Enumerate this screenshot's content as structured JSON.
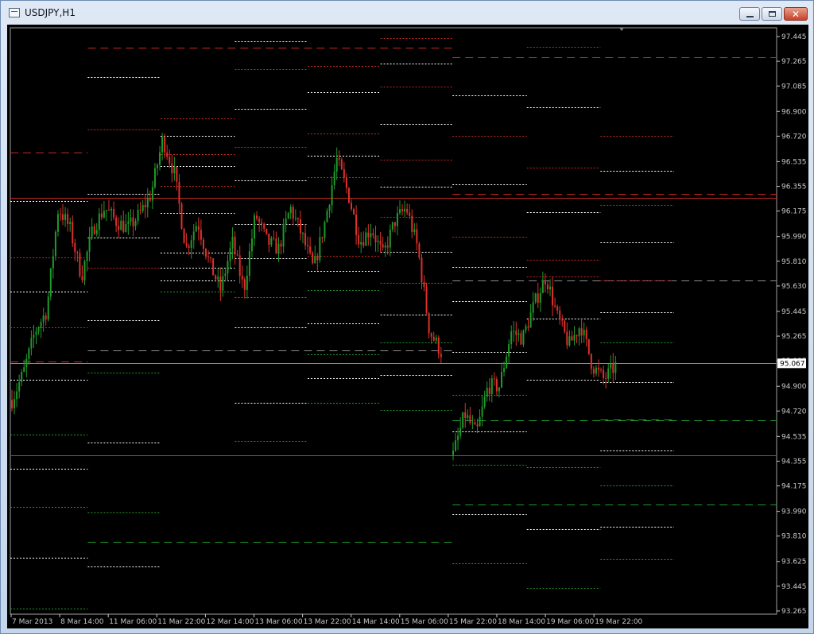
{
  "window": {
    "title": "USDJPY,H1",
    "buttons": {
      "minimize": "minimize",
      "maximize": "maximize",
      "close": "close"
    }
  },
  "colors": {
    "background": "#000000",
    "bull": "#1f9a2a",
    "bear": "#e0302a",
    "axis": "#c8c8c8",
    "level_white": "#ffffff",
    "level_red": "#c22a20",
    "level_green": "#1f9a2a",
    "level_gray": "#8c8c8c",
    "price_tag_bg": "#ffffff"
  },
  "chart_data": {
    "type": "candlestick",
    "symbol": "USDJPY",
    "timeframe": "H1",
    "ylim": [
      93.265,
      97.445
    ],
    "y_ticks": [
      "97.445",
      "97.265",
      "97.085",
      "96.900",
      "96.720",
      "96.535",
      "96.355",
      "96.175",
      "95.990",
      "95.810",
      "95.630",
      "95.445",
      "95.265",
      "95.085",
      "94.900",
      "94.720",
      "94.535",
      "94.355",
      "94.175",
      "93.990",
      "93.810",
      "93.625",
      "93.445",
      "93.265"
    ],
    "x_ticks": [
      "7 Mar 2013",
      "8 Mar 14:00",
      "11 Mar 06:00",
      "11 Mar 22:00",
      "12 Mar 14:00",
      "13 Mar 06:00",
      "13 Mar 22:00",
      "14 Mar 14:00",
      "15 Mar 06:00",
      "15 Mar 22:00",
      "18 Mar 14:00",
      "19 Mar 06:00",
      "19 Mar 22:00"
    ],
    "current_price": "95.067",
    "price_trend": [
      [
        94.8,
        95.0,
        95.3,
        95.45,
        96.2,
        96.05,
        95.7,
        96.05,
        96.2,
        96.1,
        96.05,
        96.15,
        96.3,
        96.7,
        96.45,
        95.9,
        96.1,
        95.8,
        95.6,
        95.95,
        95.6,
        96.15,
        95.95,
        95.9,
        96.2,
        96.0,
        95.75,
        96.1,
        96.55,
        96.3,
        95.95,
        96.05,
        95.85,
        96.1,
        96.2,
        95.9,
        95.3,
        95.15
      ],
      [
        94.4,
        94.7,
        94.55,
        94.9,
        94.9,
        95.3,
        95.25,
        95.5,
        95.7,
        95.4,
        95.2,
        95.35,
        95.05,
        94.95,
        95.05
      ]
    ],
    "levels": [
      {
        "color": "red",
        "dash": "long",
        "x0": 0.101,
        "x1": 0.577,
        "price": 97.365
      },
      {
        "color": "white",
        "dash": "short",
        "x0": 0.293,
        "x1": 0.388,
        "price": 97.41
      },
      {
        "color": "red",
        "dash": "short",
        "x0": 0.483,
        "x1": 0.577,
        "price": 97.435
      },
      {
        "color": "red",
        "dash": "long",
        "x0": 0.577,
        "x1": 1.0,
        "price": 97.295
      },
      {
        "color": "red",
        "dash": "short",
        "x0": 0.674,
        "x1": 0.77,
        "price": 97.37
      },
      {
        "color": "white",
        "dash": "short",
        "x0": 0.101,
        "x1": 0.196,
        "price": 97.15
      },
      {
        "color": "red",
        "dash": "short",
        "x0": 0.293,
        "x1": 0.388,
        "price": 97.21
      },
      {
        "color": "red",
        "dash": "short",
        "x0": 0.388,
        "x1": 0.483,
        "price": 97.23
      },
      {
        "color": "white",
        "dash": "short",
        "x0": 0.483,
        "x1": 0.577,
        "price": 97.25
      },
      {
        "color": "white",
        "dash": "short",
        "x0": 0.388,
        "x1": 0.483,
        "price": 97.04
      },
      {
        "color": "red",
        "dash": "short",
        "x0": 0.483,
        "x1": 0.577,
        "price": 97.08
      },
      {
        "color": "white",
        "dash": "short",
        "x0": 0.577,
        "x1": 0.674,
        "price": 97.02
      },
      {
        "color": "white",
        "dash": "short",
        "x0": 0.293,
        "x1": 0.388,
        "price": 96.92
      },
      {
        "color": "white",
        "dash": "short",
        "x0": 0.674,
        "x1": 0.77,
        "price": 96.93
      },
      {
        "color": "red",
        "dash": "short",
        "x0": 0.196,
        "x1": 0.293,
        "price": 96.85
      },
      {
        "color": "white",
        "dash": "short",
        "x0": 0.483,
        "x1": 0.577,
        "price": 96.81
      },
      {
        "color": "red",
        "dash": "short",
        "x0": 0.101,
        "x1": 0.196,
        "price": 96.77
      },
      {
        "color": "white",
        "dash": "short",
        "x0": 0.196,
        "x1": 0.293,
        "price": 96.72
      },
      {
        "color": "red",
        "dash": "short",
        "x0": 0.388,
        "x1": 0.483,
        "price": 96.74
      },
      {
        "color": "red",
        "dash": "short",
        "x0": 0.577,
        "x1": 0.674,
        "price": 96.72
      },
      {
        "color": "red",
        "dash": "short",
        "x0": 0.77,
        "x1": 0.866,
        "price": 96.72
      },
      {
        "color": "red",
        "dash": "long",
        "x0": 0.0,
        "x1": 0.101,
        "price": 96.6
      },
      {
        "color": "red",
        "dash": "short",
        "x0": 0.293,
        "x1": 0.388,
        "price": 96.64
      },
      {
        "color": "white",
        "dash": "short",
        "x0": 0.388,
        "x1": 0.483,
        "price": 96.58
      },
      {
        "color": "red",
        "dash": "short",
        "x0": 0.483,
        "x1": 0.577,
        "price": 96.55
      },
      {
        "color": "red",
        "dash": "short",
        "x0": 0.196,
        "x1": 0.293,
        "price": 96.59
      },
      {
        "color": "white",
        "dash": "short",
        "x0": 0.196,
        "x1": 0.293,
        "price": 96.5
      },
      {
        "color": "red",
        "dash": "short",
        "x0": 0.674,
        "x1": 0.77,
        "price": 96.49
      },
      {
        "color": "white",
        "dash": "short",
        "x0": 0.77,
        "x1": 0.866,
        "price": 96.47
      },
      {
        "color": "white",
        "dash": "short",
        "x0": 0.293,
        "x1": 0.388,
        "price": 96.4
      },
      {
        "color": "red",
        "dash": "short",
        "x0": 0.388,
        "x1": 0.483,
        "price": 96.42
      },
      {
        "color": "white",
        "dash": "short",
        "x0": 0.577,
        "x1": 0.674,
        "price": 96.37
      },
      {
        "color": "white",
        "dash": "short",
        "x0": 0.483,
        "x1": 0.577,
        "price": 96.35
      },
      {
        "color": "red",
        "dash": "short",
        "x0": 0.196,
        "x1": 0.293,
        "price": 96.36
      },
      {
        "color": "red",
        "dash": "solid",
        "x0": 0.0,
        "x1": 1.0,
        "price": 96.27
      },
      {
        "color": "red",
        "dash": "long",
        "x0": 0.577,
        "x1": 1.0,
        "price": 96.3
      },
      {
        "color": "white",
        "dash": "short",
        "x0": 0.101,
        "x1": 0.196,
        "price": 96.3
      },
      {
        "color": "white",
        "dash": "short",
        "x0": 0.0,
        "x1": 0.101,
        "price": 96.25
      },
      {
        "color": "red",
        "dash": "short",
        "x0": 0.77,
        "x1": 0.866,
        "price": 96.22
      },
      {
        "color": "white",
        "dash": "short",
        "x0": 0.674,
        "x1": 0.77,
        "price": 96.17
      },
      {
        "color": "red",
        "dash": "short",
        "x0": 0.483,
        "x1": 0.577,
        "price": 96.13
      },
      {
        "color": "white",
        "dash": "short",
        "x0": 0.196,
        "x1": 0.293,
        "price": 96.16
      },
      {
        "color": "white",
        "dash": "short",
        "x0": 0.293,
        "x1": 0.388,
        "price": 96.08
      },
      {
        "color": "white",
        "dash": "short",
        "x0": 0.77,
        "x1": 0.866,
        "price": 95.95
      },
      {
        "color": "red",
        "dash": "short",
        "x0": 0.577,
        "x1": 0.674,
        "price": 95.99
      },
      {
        "color": "white",
        "dash": "short",
        "x0": 0.101,
        "x1": 0.196,
        "price": 95.98
      },
      {
        "color": "white",
        "dash": "short",
        "x0": 0.483,
        "x1": 0.577,
        "price": 95.88
      },
      {
        "color": "red",
        "dash": "short",
        "x0": 0.388,
        "x1": 0.483,
        "price": 95.85
      },
      {
        "color": "white",
        "dash": "short",
        "x0": 0.196,
        "x1": 0.293,
        "price": 95.87
      },
      {
        "color": "red",
        "dash": "short",
        "x0": 0.0,
        "x1": 0.101,
        "price": 95.84
      },
      {
        "color": "white",
        "dash": "short",
        "x0": 0.293,
        "x1": 0.388,
        "price": 95.83
      },
      {
        "color": "red",
        "dash": "short",
        "x0": 0.674,
        "x1": 0.77,
        "price": 95.82
      },
      {
        "color": "white",
        "dash": "short",
        "x0": 0.577,
        "x1": 0.674,
        "price": 95.77
      },
      {
        "color": "red",
        "dash": "short",
        "x0": 0.101,
        "x1": 0.196,
        "price": 95.76
      },
      {
        "color": "white",
        "dash": "short",
        "x0": 0.196,
        "x1": 0.293,
        "price": 95.76
      },
      {
        "color": "white",
        "dash": "short",
        "x0": 0.388,
        "x1": 0.483,
        "price": 95.74
      },
      {
        "color": "red",
        "dash": "short",
        "x0": 0.674,
        "x1": 0.77,
        "price": 95.7
      },
      {
        "color": "gray",
        "dash": "long",
        "x0": 0.577,
        "x1": 1.0,
        "price": 95.67
      },
      {
        "color": "red",
        "dash": "short",
        "x0": 0.77,
        "x1": 0.866,
        "price": 95.67
      },
      {
        "color": "white",
        "dash": "short",
        "x0": 0.196,
        "x1": 0.293,
        "price": 95.67
      },
      {
        "color": "green",
        "dash": "short",
        "x0": 0.483,
        "x1": 0.577,
        "price": 95.65
      },
      {
        "color": "white",
        "dash": "short",
        "x0": 0.0,
        "x1": 0.101,
        "price": 95.59
      },
      {
        "color": "green",
        "dash": "short",
        "x0": 0.196,
        "x1": 0.293,
        "price": 95.59
      },
      {
        "color": "green",
        "dash": "short",
        "x0": 0.388,
        "x1": 0.483,
        "price": 95.6
      },
      {
        "color": "green",
        "dash": "short",
        "x0": 0.293,
        "x1": 0.388,
        "price": 95.55
      },
      {
        "color": "white",
        "dash": "short",
        "x0": 0.577,
        "x1": 0.674,
        "price": 95.52
      },
      {
        "color": "white",
        "dash": "short",
        "x0": 0.483,
        "x1": 0.577,
        "price": 95.42
      },
      {
        "color": "white",
        "dash": "short",
        "x0": 0.77,
        "x1": 0.866,
        "price": 95.44
      },
      {
        "color": "white",
        "dash": "short",
        "x0": 0.674,
        "x1": 0.77,
        "price": 95.39
      },
      {
        "color": "white",
        "dash": "short",
        "x0": 0.101,
        "x1": 0.196,
        "price": 95.38
      },
      {
        "color": "white",
        "dash": "short",
        "x0": 0.388,
        "x1": 0.483,
        "price": 95.36
      },
      {
        "color": "red",
        "dash": "short",
        "x0": 0.0,
        "x1": 0.101,
        "price": 95.33
      },
      {
        "color": "white",
        "dash": "short",
        "x0": 0.293,
        "x1": 0.388,
        "price": 95.33
      },
      {
        "color": "green",
        "dash": "short",
        "x0": 0.483,
        "x1": 0.577,
        "price": 95.22
      },
      {
        "color": "green",
        "dash": "short",
        "x0": 0.77,
        "x1": 0.866,
        "price": 95.22
      },
      {
        "color": "gray",
        "dash": "long",
        "x0": 0.101,
        "x1": 0.577,
        "price": 95.16
      },
      {
        "color": "white",
        "dash": "short",
        "x0": 0.577,
        "x1": 0.674,
        "price": 95.15
      },
      {
        "color": "green",
        "dash": "short",
        "x0": 0.388,
        "x1": 0.483,
        "price": 95.13
      },
      {
        "color": "red",
        "dash": "long",
        "x0": 0.0,
        "x1": 0.101,
        "price": 95.08
      },
      {
        "color": "gray",
        "dash": "solid",
        "x0": 0.0,
        "x1": 1.0,
        "price": 95.067
      },
      {
        "color": "green",
        "dash": "short",
        "x0": 0.101,
        "x1": 0.196,
        "price": 95.0
      },
      {
        "color": "white",
        "dash": "short",
        "x0": 0.483,
        "x1": 0.577,
        "price": 94.98
      },
      {
        "color": "white",
        "dash": "short",
        "x0": 0.0,
        "x1": 0.101,
        "price": 94.95
      },
      {
        "color": "white",
        "dash": "short",
        "x0": 0.388,
        "x1": 0.483,
        "price": 94.96
      },
      {
        "color": "white",
        "dash": "short",
        "x0": 0.674,
        "x1": 0.77,
        "price": 94.95
      },
      {
        "color": "white",
        "dash": "short",
        "x0": 0.77,
        "x1": 0.866,
        "price": 94.93
      },
      {
        "color": "green",
        "dash": "short",
        "x0": 0.577,
        "x1": 0.674,
        "price": 94.84
      },
      {
        "color": "white",
        "dash": "short",
        "x0": 0.293,
        "x1": 0.388,
        "price": 94.78
      },
      {
        "color": "white",
        "dash": "short",
        "x0": 0.388,
        "x1": 0.483,
        "price": 94.78
      },
      {
        "color": "green",
        "dash": "short",
        "x0": 0.388,
        "x1": 0.483,
        "price": 94.78
      },
      {
        "color": "green",
        "dash": "short",
        "x0": 0.483,
        "x1": 0.577,
        "price": 94.73
      },
      {
        "color": "green",
        "dash": "long",
        "x0": 0.577,
        "x1": 1.0,
        "price": 94.65
      },
      {
        "color": "green",
        "dash": "long",
        "x0": 0.77,
        "x1": 0.866,
        "price": 94.66
      },
      {
        "color": "white",
        "dash": "short",
        "x0": 0.577,
        "x1": 0.674,
        "price": 94.57
      },
      {
        "color": "green",
        "dash": "short",
        "x0": 0.0,
        "x1": 0.101,
        "price": 94.55
      },
      {
        "color": "white",
        "dash": "short",
        "x0": 0.101,
        "x1": 0.196,
        "price": 94.49
      },
      {
        "color": "green",
        "dash": "short",
        "x0": 0.293,
        "x1": 0.388,
        "price": 94.5
      },
      {
        "color": "white",
        "dash": "short",
        "x0": 0.77,
        "x1": 0.866,
        "price": 94.43
      },
      {
        "color": "red",
        "dash": "solid",
        "x0": 0.0,
        "x1": 1.0,
        "price": 94.4
      },
      {
        "color": "green",
        "dash": "short",
        "x0": 0.577,
        "x1": 0.674,
        "price": 94.33
      },
      {
        "color": "green",
        "dash": "short",
        "x0": 0.674,
        "x1": 0.77,
        "price": 94.31
      },
      {
        "color": "white",
        "dash": "short",
        "x0": 0.0,
        "x1": 0.101,
        "price": 94.3
      },
      {
        "color": "green",
        "dash": "short",
        "x0": 0.77,
        "x1": 0.866,
        "price": 94.18
      },
      {
        "color": "green",
        "dash": "long",
        "x0": 0.577,
        "x1": 1.0,
        "price": 94.04
      },
      {
        "color": "green",
        "dash": "short",
        "x0": 0.0,
        "x1": 0.101,
        "price": 94.02
      },
      {
        "color": "white",
        "dash": "short",
        "x0": 0.577,
        "x1": 0.674,
        "price": 93.97
      },
      {
        "color": "green",
        "dash": "short",
        "x0": 0.101,
        "x1": 0.196,
        "price": 93.98
      },
      {
        "color": "white",
        "dash": "short",
        "x0": 0.77,
        "x1": 0.866,
        "price": 93.88
      },
      {
        "color": "white",
        "dash": "short",
        "x0": 0.674,
        "x1": 0.77,
        "price": 93.86
      },
      {
        "color": "green",
        "dash": "long",
        "x0": 0.101,
        "x1": 0.577,
        "price": 93.77
      },
      {
        "color": "white",
        "dash": "short",
        "x0": 0.0,
        "x1": 0.101,
        "price": 93.65
      },
      {
        "color": "green",
        "dash": "short",
        "x0": 0.77,
        "x1": 0.866,
        "price": 93.64
      },
      {
        "color": "white",
        "dash": "short",
        "x0": 0.101,
        "x1": 0.196,
        "price": 93.59
      },
      {
        "color": "green",
        "dash": "short",
        "x0": 0.577,
        "x1": 0.674,
        "price": 93.61
      },
      {
        "color": "green",
        "dash": "short",
        "x0": 0.674,
        "x1": 0.77,
        "price": 93.43
      },
      {
        "color": "green",
        "dash": "short",
        "x0": 0.0,
        "x1": 0.101,
        "price": 93.28
      }
    ]
  }
}
